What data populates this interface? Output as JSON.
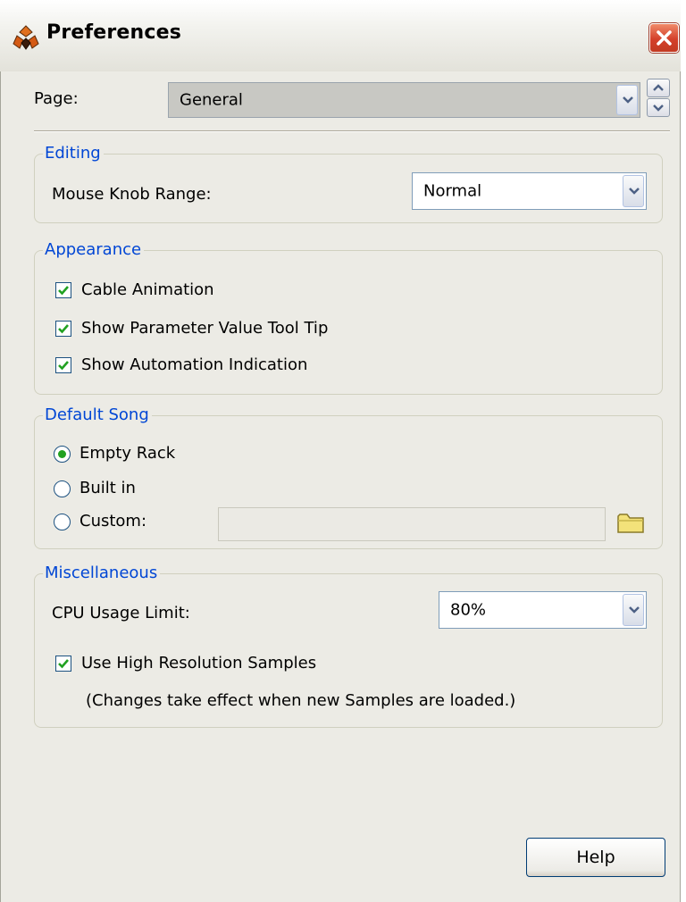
{
  "window": {
    "title": "Preferences"
  },
  "page_selector": {
    "label": "Page:",
    "value": "General"
  },
  "editing": {
    "title": "Editing",
    "mouse_knob_label": "Mouse Knob Range:",
    "mouse_knob_value": "Normal"
  },
  "appearance": {
    "title": "Appearance",
    "items": [
      {
        "label": "Cable Animation",
        "checked": true
      },
      {
        "label": "Show Parameter Value Tool Tip",
        "checked": true
      },
      {
        "label": "Show Automation Indication",
        "checked": true
      }
    ]
  },
  "default_song": {
    "title": "Default Song",
    "options": [
      {
        "label": "Empty Rack",
        "selected": true
      },
      {
        "label": "Built in",
        "selected": false
      },
      {
        "label": "Custom:",
        "selected": false
      }
    ],
    "custom_path": ""
  },
  "misc": {
    "title": "Miscellaneous",
    "cpu_label": "CPU Usage Limit:",
    "cpu_value": "80%",
    "hires_label": "Use High Resolution Samples",
    "hires_checked": true,
    "note": "(Changes take effect when new Samples are loaded.)"
  },
  "buttons": {
    "help": "Help"
  },
  "icons": {
    "app": "reason-app-icon",
    "close": "close-icon",
    "dropdown": "chevron-down-icon",
    "spin_up": "spin-up-icon",
    "spin_down": "spin-down-icon",
    "folder": "folder-icon",
    "check": "checkmark-icon"
  },
  "colors": {
    "group_title": "#0046d5",
    "check_green": "#21a121",
    "close_red": "#d4402a",
    "dialog_bg": "#ecebe5"
  }
}
